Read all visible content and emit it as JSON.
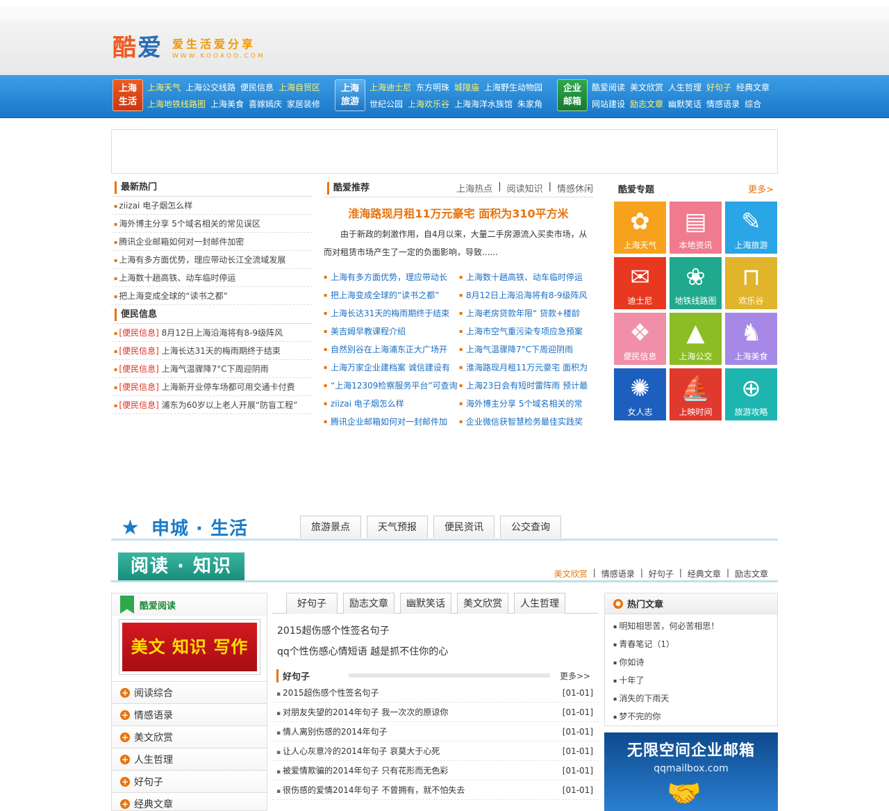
{
  "logo": {
    "mark_a": "酷",
    "mark_b": "爱",
    "slogan": "爱生活爱分享",
    "domain": "WWW.KOOAOO.COM"
  },
  "nav": {
    "g1": {
      "badge": [
        "上海",
        "生活"
      ],
      "row1": [
        "上海天气",
        "上海公交线路",
        "便民信息",
        "上海自贸区"
      ],
      "row1_hl": [
        true,
        false,
        false,
        true
      ],
      "row2": [
        "上海地铁线路图",
        "上海美食",
        "喜嫁嫣庆",
        "家居装修"
      ],
      "row2_hl": [
        true,
        false,
        false,
        false
      ]
    },
    "g2": {
      "badge": [
        "上海",
        "旅游"
      ],
      "row1": [
        "上海迪士尼",
        "东方明珠",
        "城隍庙",
        "上海野生动物园"
      ],
      "row1_hl": [
        true,
        false,
        true,
        false
      ],
      "row2": [
        "世纪公园",
        "上海欢乐谷",
        "上海海洋水族馆",
        "朱家角"
      ],
      "row2_hl": [
        false,
        true,
        false,
        false
      ]
    },
    "g3": {
      "badge": [
        "企业",
        "邮箱"
      ],
      "row1": [
        "酷爱阅读",
        "美文欣赏",
        "人生哲理",
        "好句子",
        "经典文章"
      ],
      "row1_hl": [
        false,
        false,
        false,
        true,
        false
      ],
      "row2": [
        "网站建设",
        "励志文章",
        "幽默笑话",
        "情感语录",
        "综合"
      ],
      "row2_hl": [
        false,
        true,
        false,
        false,
        false
      ]
    }
  },
  "hot": {
    "title": "最新热门",
    "items": [
      "ziizai 电子烟怎么样",
      "海外博主分享 5个域名相关的常见误区",
      "腾讯企业邮箱如何对一封邮件加密",
      "上海有多方面优势，理应带动长江全流域发展",
      "上海数十趟高铁、动车临时停运",
      "把上海变成全球的“读书之都”"
    ]
  },
  "info": {
    "title": "便民信息",
    "tag": "[便民信息]",
    "items": [
      "8月12日上海沿海将有8-9级阵风",
      "上海长达31天的梅雨期终于结束",
      "上海气温骤降7°C下周迎阴雨",
      "上海新开业停车场都可用交通卡付费",
      "浦东为60岁以上老人开展“防盲工程”"
    ]
  },
  "rec": {
    "title": "酷爱推荐",
    "tabs": [
      "上海热点",
      "阅读知识",
      "情感休闲"
    ],
    "headline": "淮海路现月租11万元豪宅 面积为310平方米",
    "summary": "由于新政的刺激作用，自4月以来，大量二手房源流入买卖市场，从而对租赁市场产生了一定的负面影响，导致......",
    "links": [
      "上海有多方面优势，理应带动长",
      "上海数十趟高铁、动车临时停运",
      "把上海变成全球的“读书之都”",
      "8月12日上海沿海将有8-9级阵风",
      "上海长达31天的梅雨期终于结束",
      "上海老房贷款年限“ 贷款+楼龄",
      "美吉姆早教课程介绍",
      "上海市空气重污染专项应急预案",
      "自然别谷在上海浦东正大广场开",
      "上海气温骤降7°C下周迎阴雨",
      "上海万家企业建档案 诚信建设有",
      "淮海路现月租11万元豪宅 面积为",
      "“上海12309检察服务平台”可查询",
      "上海23日会有短时雷阵雨 预计最",
      "ziizai 电子烟怎么样",
      "海外博主分享 5个域名相关的常",
      "腾讯企业邮箱如何对一封邮件加",
      "企业微信获智慧检务最佳实践奖"
    ]
  },
  "topics": {
    "title": "酷爱专题",
    "more": "更多>",
    "tiles": [
      {
        "label": "上海天气",
        "color": "#f7a21c",
        "icon": "butterfly-icon",
        "glyph": "✿"
      },
      {
        "label": "本地资讯",
        "color": "#f07b8e",
        "icon": "drum-icon",
        "glyph": "▤"
      },
      {
        "label": "上海旅游",
        "color": "#2aa5e6",
        "icon": "paper-icon",
        "glyph": "✎"
      },
      {
        "label": "迪士尼",
        "color": "#e8381f",
        "icon": "mail-icon",
        "glyph": "✉"
      },
      {
        "label": "地铁线路图",
        "color": "#21a98e",
        "icon": "flower-icon",
        "glyph": "❀"
      },
      {
        "label": "欢乐谷",
        "color": "#e0b52c",
        "icon": "bench-icon",
        "glyph": "⊓"
      },
      {
        "label": "便民信息",
        "color": "#f18fa8",
        "icon": "frame-icon",
        "glyph": "❖"
      },
      {
        "label": "上海公交",
        "color": "#8cbd25",
        "icon": "triangle-icon",
        "glyph": "▲"
      },
      {
        "label": "上海美食",
        "color": "#a689e6",
        "icon": "person-icon",
        "glyph": "♞"
      },
      {
        "label": "女人志",
        "color": "#1d5fbe",
        "icon": "snowflake-icon",
        "glyph": "✺"
      },
      {
        "label": "上映时间",
        "color": "#e0392e",
        "icon": "ship-icon",
        "glyph": "⛵"
      },
      {
        "label": "旅游攻略",
        "color": "#1eb4b0",
        "icon": "globe-search-icon",
        "glyph": "⊕"
      }
    ]
  },
  "shencheng": {
    "title": "申城 · 生活",
    "tabs": [
      "旅游景点",
      "天气预报",
      "便民资讯",
      "公交查询"
    ]
  },
  "reading": {
    "title": "阅读 · 知识",
    "links": [
      "美文欣赏",
      "情感语录",
      "好句子",
      "经典文章",
      "励志文章"
    ]
  },
  "kooread": {
    "title": "酷爱阅读",
    "banner": "美文 知识 写作",
    "items": [
      "阅读综合",
      "情感语录",
      "美文欣赏",
      "人生哲理",
      "好句子",
      "经典文章"
    ]
  },
  "mid": {
    "tabs": [
      "好句子",
      "励志文章",
      "幽默笑话",
      "美文欣赏",
      "人生哲理"
    ],
    "top": [
      "2015超伤感个性签名句子",
      "qq个性伤感心情短语 越是抓不住你的心"
    ],
    "section": "好句子",
    "more": "更多>>",
    "items": [
      [
        "2015超伤感个性签名句子",
        "[01-01]"
      ],
      [
        "对朋友失望的2014年句子 我一次次的原谅你",
        "[01-01]"
      ],
      [
        "情人离别伤感的2014年句子",
        "[01-01]"
      ],
      [
        "让人心灰意冷的2014年句子 哀莫大于心死",
        "[01-01]"
      ],
      [
        "被爱情欺骗的2014年句子 只有花形而无色彩",
        "[01-01]"
      ],
      [
        "很伤感的爱情2014年句子 不曾拥有，就不怕失去",
        "[01-01]"
      ]
    ]
  },
  "hotart": {
    "title": "热门文章",
    "items": [
      "明知相思苦，何必苦相思！",
      "青春笔记（1）",
      "你如诗",
      "十年了",
      "消失的下雨天",
      "梦不完的你"
    ]
  },
  "ad": {
    "title": "无限空间企业邮箱",
    "sub": "qqmailbox.com"
  }
}
